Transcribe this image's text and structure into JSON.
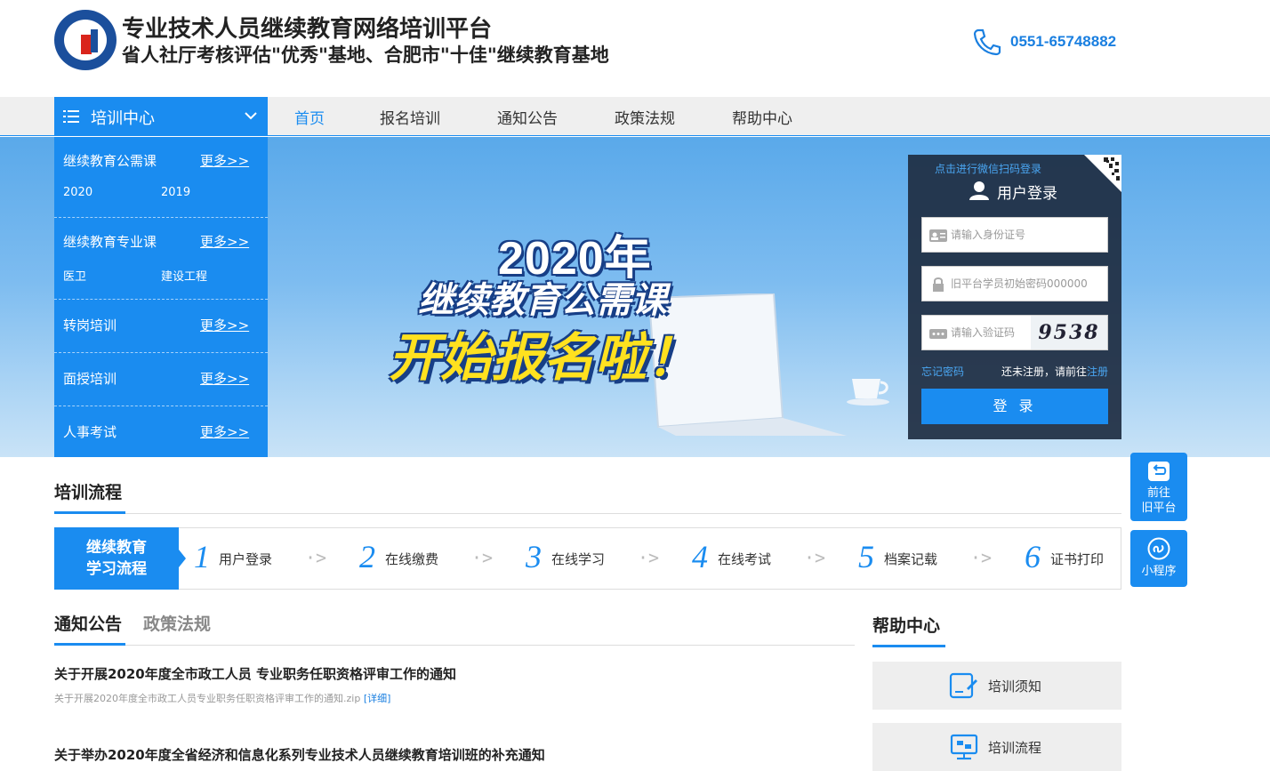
{
  "header": {
    "title": "专业技术人员继续教育网络培训平台",
    "subtitle": "省人社厅考核评估\"优秀\"基地、合肥市\"十佳\"继续教育基地",
    "phone": "0551-65748882"
  },
  "nav": {
    "training_center": "培训中心",
    "items": [
      "首页",
      "报名培训",
      "通知公告",
      "政策法规",
      "帮助中心"
    ]
  },
  "sidebar": {
    "more_label": "更多>>",
    "sections": [
      {
        "title": "继续教育公需课",
        "subs": [
          "2020",
          "2019"
        ]
      },
      {
        "title": "继续教育专业课",
        "subs": [
          "医卫",
          "建设工程"
        ]
      },
      {
        "title": "转岗培训",
        "subs": []
      },
      {
        "title": "面授培训",
        "subs": []
      },
      {
        "title": "人事考试",
        "subs": []
      }
    ]
  },
  "banner": {
    "line1": "2020年",
    "line2": "继续教育公需课",
    "line3": "开始报名啦！"
  },
  "login": {
    "wechat_link": "点击进行微信扫码登录",
    "title": "用户登录",
    "id_placeholder": "请输入身份证号",
    "password_placeholder": "旧平台学员初始密码000000",
    "captcha_placeholder": "请输入验证码",
    "captcha_value": "9538",
    "forgot": "忘记密码",
    "register_prefix": "还未注册，请前往",
    "register_link": "注册",
    "submit": "登 录"
  },
  "float": {
    "old_platform_line1": "前往",
    "old_platform_line2": "旧平台",
    "mini_program": "小程序"
  },
  "process": {
    "title": "培训流程",
    "head_line1": "继续教育",
    "head_line2": "学习流程",
    "steps": [
      {
        "num": "1",
        "label": "用户登录"
      },
      {
        "num": "2",
        "label": "在线缴费"
      },
      {
        "num": "3",
        "label": "在线学习"
      },
      {
        "num": "4",
        "label": "在线考试"
      },
      {
        "num": "5",
        "label": "档案记载"
      },
      {
        "num": "6",
        "label": "证书打印"
      }
    ]
  },
  "notices": {
    "tab_notice": "通知公告",
    "tab_policy": "政策法规",
    "items": [
      {
        "title": "关于开展2020年度全市政工人员 专业职务任职资格评审工作的通知",
        "attachment": "关于开展2020年度全市政工人员专业职务任职资格评审工作的通知.zip",
        "detail": "[详细]"
      },
      {
        "title": "关于举办2020年度全省经济和信息化系列专业技术人员继续教育培训班的补充通知"
      }
    ]
  },
  "help": {
    "title": "帮助中心",
    "items": [
      "培训须知",
      "培训流程"
    ]
  },
  "colors": {
    "primary": "#1a8cf0",
    "banner_yellow": "#ffe11f",
    "login_bg": "#1e2d41"
  }
}
